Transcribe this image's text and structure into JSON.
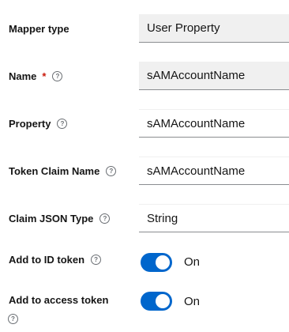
{
  "fields": {
    "mapper_type": {
      "label": "Mapper type",
      "value": "User Property"
    },
    "name": {
      "label": "Name",
      "required_mark": "*",
      "value": "sAMAccountName"
    },
    "property": {
      "label": "Property",
      "value": "sAMAccountName"
    },
    "token_claim_name": {
      "label": "Token Claim Name",
      "value": "sAMAccountName"
    },
    "claim_json_type": {
      "label": "Claim JSON Type",
      "value": "String"
    }
  },
  "toggles": {
    "add_to_id_token": {
      "label": "Add to ID token",
      "state": "On",
      "enabled": true
    },
    "add_to_access_token": {
      "label": "Add to access token",
      "state": "On",
      "enabled": true
    }
  },
  "help_icon_glyph": "?",
  "colors": {
    "toggle_on": "#0066cc",
    "required": "#c9190b",
    "readonly_bg": "#f0f0f0"
  }
}
